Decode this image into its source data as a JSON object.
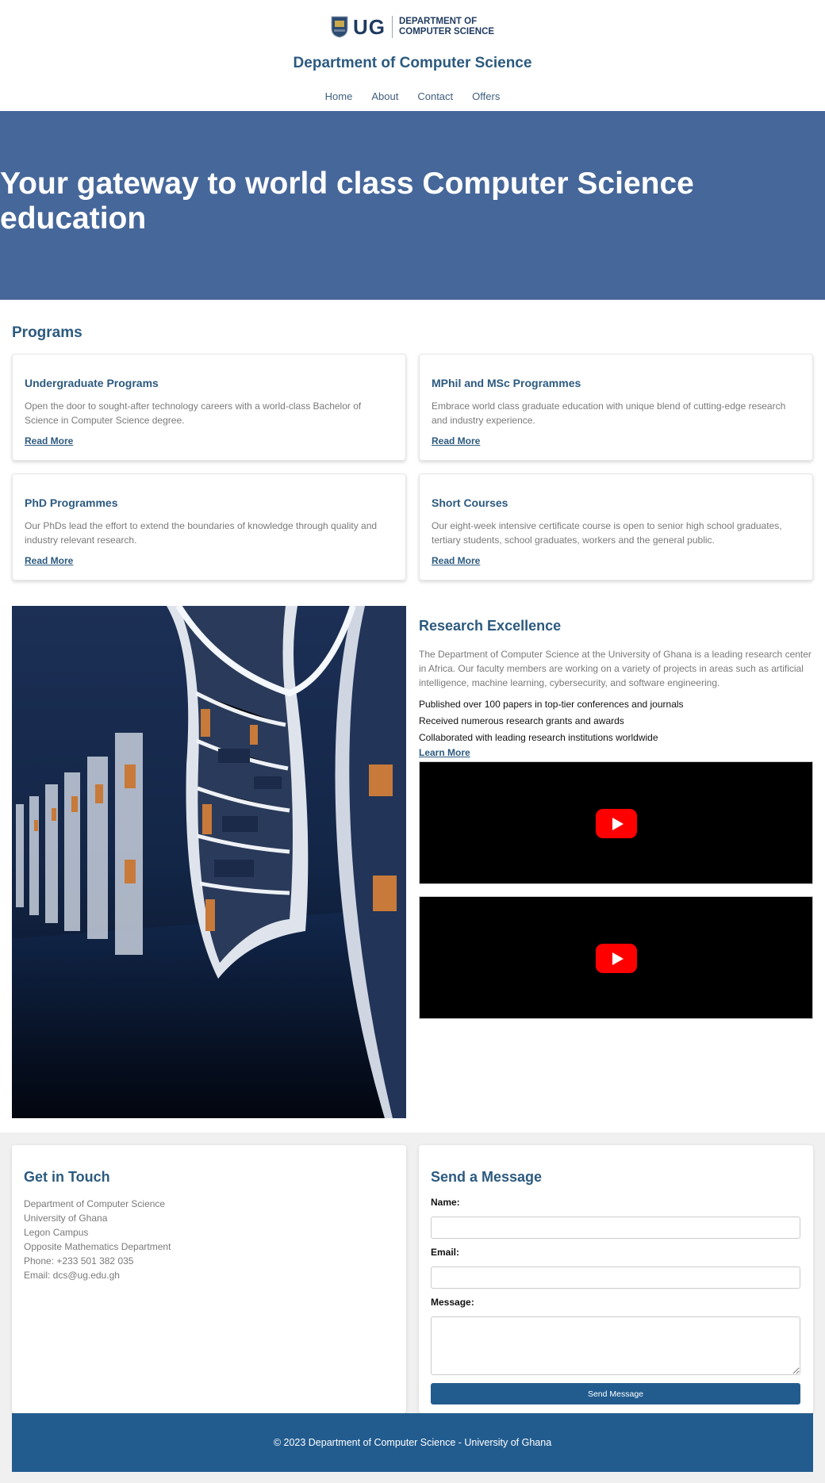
{
  "header": {
    "logo_mark": "UG",
    "logo_line1": "DEPARTMENT OF",
    "logo_line2": "COMPUTER SCIENCE",
    "site_title": "Department of Computer Science",
    "nav": [
      "Home",
      "About",
      "Contact",
      "Offers"
    ]
  },
  "hero": {
    "headline": "Your gateway to world class Computer Science education"
  },
  "programs": {
    "title": "Programs",
    "cards": [
      {
        "title": "Undergraduate Programs",
        "text": "Open the door to sought-after technology careers with a world-class Bachelor of Science in Computer Science degree.",
        "link": "Read More"
      },
      {
        "title": "MPhil and MSc Programmes",
        "text": "Embrace world class graduate education with unique blend of cutting-edge research and industry experience.",
        "link": "Read More"
      },
      {
        "title": "PhD Programmes",
        "text": "Our PhDs lead the effort to extend the boundaries of knowledge through quality and industry relevant research.",
        "link": "Read More"
      },
      {
        "title": "Short Courses",
        "text": "Our eight-week intensive certificate course is open to senior high school graduates, tertiary students, school graduates, workers and the general public.",
        "link": "Read More"
      }
    ]
  },
  "research": {
    "title": "Research Excellence",
    "text": "The Department of Computer Science at the University of Ghana is a leading research center in Africa. Our faculty members are working on a variety of projects in areas such as artificial intelligence, machine learning, cybersecurity, and software engineering.",
    "bullets": [
      "Published over 100 papers in top-tier conferences and journals",
      "Received numerous research grants and awards",
      "Collaborated with leading research institutions worldwide"
    ],
    "link": "Learn More"
  },
  "contact": {
    "title": "Get in Touch",
    "address": [
      "Department of Computer Science",
      "University of Ghana",
      "Legon Campus",
      "Opposite Mathematics Department",
      "Phone: +233 501 382 035",
      "Email: dcs@ug.edu.gh"
    ]
  },
  "message_form": {
    "title": "Send a Message",
    "name_label": "Name:",
    "email_label": "Email:",
    "message_label": "Message:",
    "name_value": "",
    "email_value": "",
    "message_value": "",
    "submit_label": "Send Message"
  },
  "footer": {
    "text": "© 2023 Department of Computer Science - University of Ghana"
  },
  "colors": {
    "brand_blue": "#2c5a7f",
    "hero_bg": "#46679a",
    "button_bg": "#225c8f",
    "youtube_red": "#ff0000"
  },
  "icons": [
    "ug-crest-icon",
    "youtube-play-icon"
  ]
}
